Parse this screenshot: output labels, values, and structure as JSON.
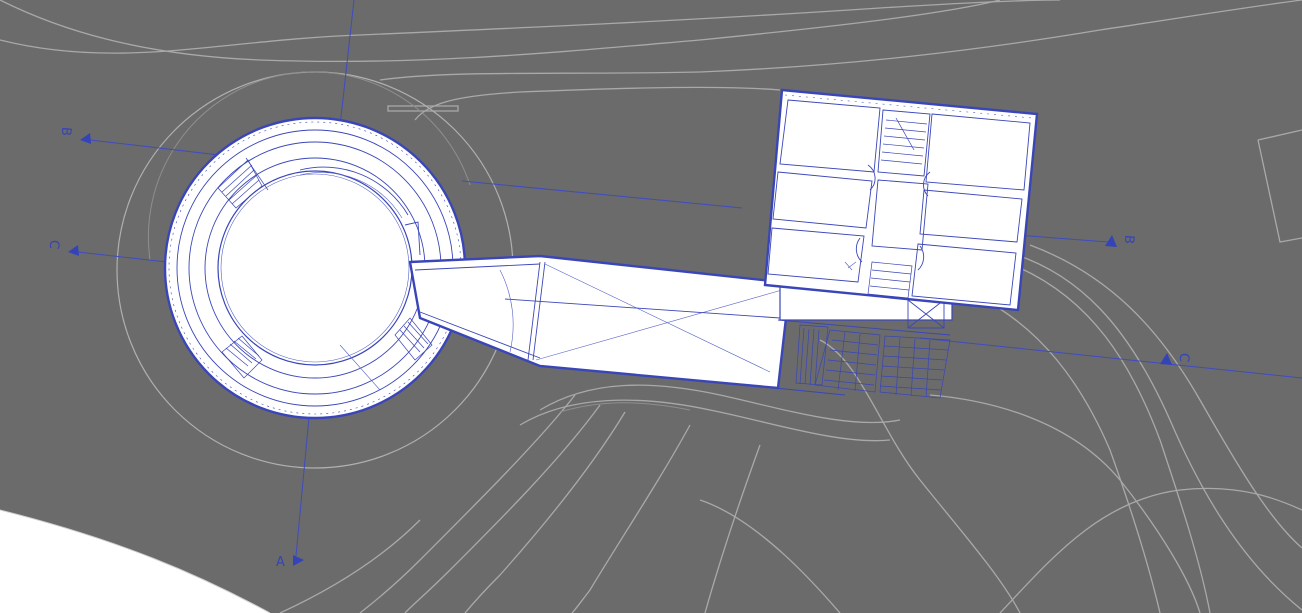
{
  "plan": {
    "section_markers": [
      {
        "id": "marker-b-left",
        "label": "B"
      },
      {
        "id": "marker-c-left",
        "label": "C"
      },
      {
        "id": "marker-a-bottom",
        "label": "A"
      },
      {
        "id": "marker-b-right",
        "label": "B"
      },
      {
        "id": "marker-c-right",
        "label": "C"
      }
    ],
    "colors": {
      "ground": "#6b6b6b",
      "contour": "#a9a9a9",
      "linework": "#3a46b8",
      "building_fill": "#ffffff",
      "outside_site": "#ffffff"
    }
  }
}
